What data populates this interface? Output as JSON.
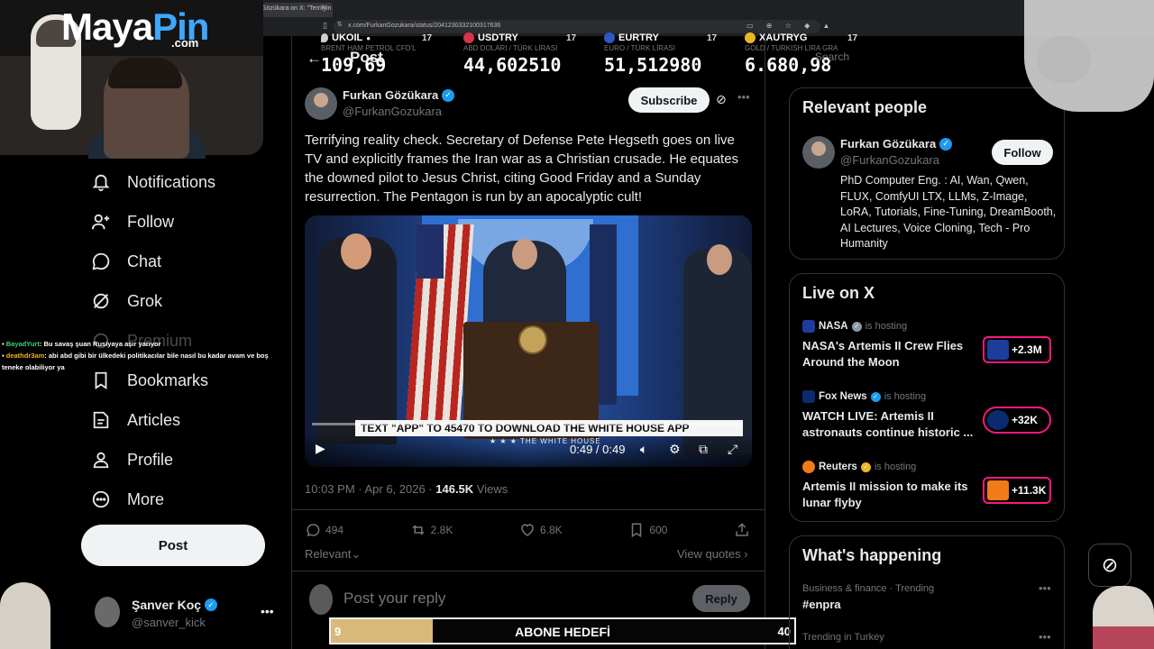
{
  "browser": {
    "tab_title": "Gözükara on X: \"Terrifyin",
    "url": "x.com/FurkanGozukara/status/2041230332100317636"
  },
  "overlay": {
    "logo_maya": "Maya",
    "logo_pin": "Pin",
    "logo_com": ".com",
    "chat": [
      {
        "user": "BayadYurt",
        "text": ": Bu savaş şuan Rusiyaya aşır yarıyor"
      },
      {
        "user": "deathdr3am",
        "text": ": abi abd gibi bir ülkedeki politikacılar bile nasıl bu kadar avam ve boş teneke olabiliyor ya"
      }
    ],
    "goal": {
      "start": "9",
      "label": "ABONE HEDEFİ",
      "end": "40",
      "progress": 0.22
    }
  },
  "ticker": [
    {
      "symbol": "UKOIL",
      "sub": "BRENT HAM PETROL CFD'L",
      "value": "109,69",
      "color": "#cfcfcf"
    },
    {
      "symbol": "USDTRY",
      "sub": "ABD DOLARI / TÜRK LİRASI",
      "value": "44,602510",
      "color": "#d9344b"
    },
    {
      "symbol": "EURTRY",
      "sub": "EURO / TÜRK LİRASI",
      "value": "51,512980",
      "color": "#2e58c7"
    },
    {
      "symbol": "XAUTRYG",
      "sub": "GOLD / TURKISH LIRA GRA",
      "value": "6.680,98",
      "color": "#e8b923"
    }
  ],
  "sidebar": {
    "items": [
      {
        "label": "Notifications",
        "icon": "bell-icon"
      },
      {
        "label": "Follow",
        "icon": "add-user-icon"
      },
      {
        "label": "Chat",
        "icon": "chat-bubble-icon"
      },
      {
        "label": "Grok",
        "icon": "grok-icon"
      },
      {
        "label": "Premium",
        "icon": "premium-icon"
      },
      {
        "label": "Bookmarks",
        "icon": "bookmark-icon"
      },
      {
        "label": "Articles",
        "icon": "article-icon"
      },
      {
        "label": "Profile",
        "icon": "person-icon"
      },
      {
        "label": "More",
        "icon": "more-circle-icon"
      }
    ],
    "post_label": "Post",
    "account": {
      "name": "Şanver Koç",
      "handle": "@sanver_kick"
    }
  },
  "post": {
    "header_title": "Post",
    "author_name": "Furkan Gözükara",
    "author_handle": "@FurkanGozukara",
    "subscribe_label": "Subscribe",
    "text": "Terrifying reality check. Secretary of Defense Pete Hegseth goes on live TV and explicitly frames the Iran war as a Christian crusade. He equates the downed pilot to Jesus Christ, citing Good Friday and a Sunday resurrection. The Pentagon is run by an apocalyptic cult!",
    "video": {
      "banner": "TEXT \"APP\" TO 45470 TO DOWNLOAD THE WHITE HOUSE APP",
      "banner_sub": "★ ★ ★  THE WHITE HOUSE",
      "time": "0:49 / 0:49",
      "progress": 1.0
    },
    "timestamp": "10:03 PM · Apr 6, 2026 · ",
    "views_count": "146.5K",
    "views_label": " Views",
    "stats": {
      "replies": "494",
      "reposts": "2.8K",
      "likes": "6.8K",
      "bookmarks": "600"
    },
    "sort_label": "Relevant",
    "view_quotes": "View quotes",
    "reply_placeholder": "Post your reply",
    "reply_button": "Reply"
  },
  "right": {
    "search_placeholder": "Search",
    "relevant_people": {
      "title": "Relevant people",
      "name": "Furkan Gözükara",
      "handle": "@FurkanGozukara",
      "follow_label": "Follow",
      "bio": "PhD Computer Eng. : AI, Wan, Qwen, FLUX, ComfyUI LTX, LLMs, Z-Image, LoRA, Tutorials, Fine-Tuning, DreamBooth, AI Lectures, Voice Cloning, Tech - Pro Humanity"
    },
    "live": {
      "title": "Live on X",
      "items": [
        {
          "host": "NASA",
          "hosting": "is hosting",
          "title": "NASA's Artemis II Crew Flies Around the Moon",
          "count": "+2.3M",
          "color": "#1d3c9c"
        },
        {
          "host": "Fox News",
          "hosting": "is hosting",
          "title": "WATCH LIVE: Artemis II astronauts continue historic ...",
          "count": "+32K",
          "color": "#0a2b6e"
        },
        {
          "host": "Reuters",
          "hosting": "is hosting",
          "title": "Artemis II mission to make its lunar flyby",
          "count": "+11.3K",
          "color": "#f07b17"
        }
      ]
    },
    "happening": {
      "title": "What's happening",
      "trend1_sub": "Business & finance · Trending",
      "trend1_tag": "#enpra",
      "trend2_sub": "Trending in Turkey"
    }
  }
}
